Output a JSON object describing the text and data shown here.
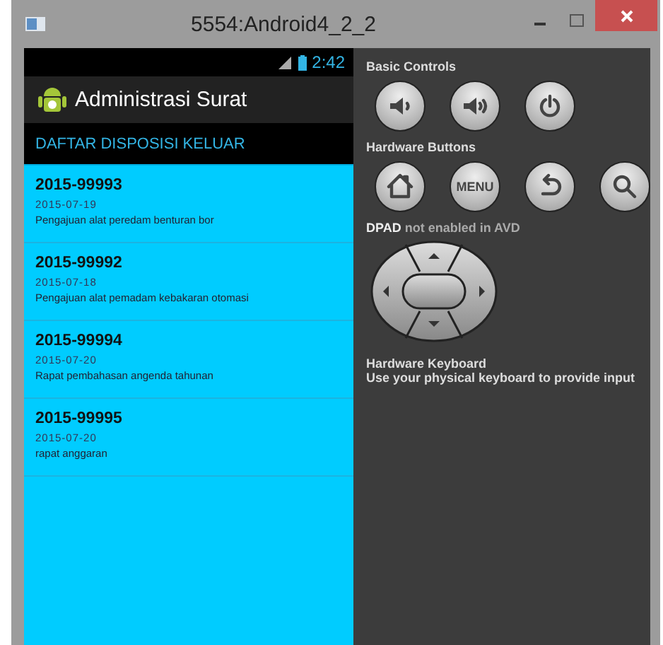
{
  "window": {
    "title": "5554:Android4_2_2"
  },
  "status_bar": {
    "time": "2:42"
  },
  "action_bar": {
    "title": "Administrasi Surat"
  },
  "list_header": "DAFTAR DISPOSISI KELUAR",
  "items": [
    {
      "number": "2015-99993",
      "date": "2015-07-19",
      "subject": "Pengajuan alat peredam benturan bor"
    },
    {
      "number": "2015-99992",
      "date": "2015-07-18",
      "subject": "Pengajuan alat pemadam kebakaran otomasi"
    },
    {
      "number": "2015-99994",
      "date": "2015-07-20",
      "subject": "Rapat pembahasan angenda tahunan"
    },
    {
      "number": "2015-99995",
      "date": "2015-07-20",
      "subject": "rapat anggaran"
    }
  ],
  "controls": {
    "basic": {
      "title": "Basic Controls",
      "buttons": [
        {
          "kind": "volume-down"
        },
        {
          "kind": "volume-up"
        },
        {
          "kind": "power"
        }
      ]
    },
    "hardware": {
      "title": "Hardware Buttons",
      "buttons": [
        {
          "kind": "home"
        },
        {
          "kind": "menu",
          "label": "MENU"
        },
        {
          "kind": "back"
        },
        {
          "kind": "search"
        }
      ]
    },
    "dpad_note": "**DPAD** not enabled in AVD",
    "keyboard": {
      "title": "Hardware Keyboard",
      "text": "Use your physical keyboard to provide input"
    }
  }
}
